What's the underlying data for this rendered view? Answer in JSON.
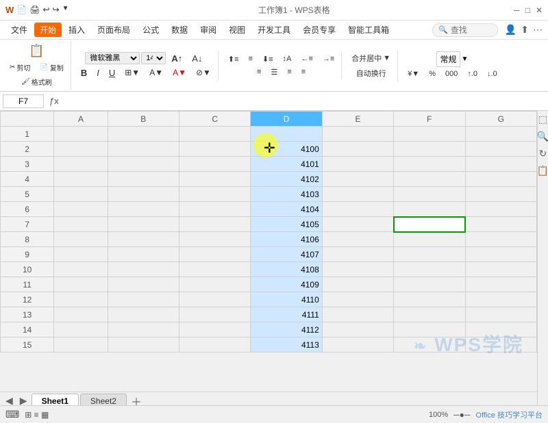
{
  "titlebar": {
    "title": "工作簿1 - WPS表格",
    "icons": [
      "⬜",
      "🖨",
      "↩",
      "↪",
      "▼"
    ]
  },
  "menubar": {
    "items": [
      "文件",
      "开始",
      "插入",
      "页面布局",
      "公式",
      "数据",
      "审阅",
      "视图",
      "开发工具",
      "会员专享",
      "智能工具箱"
    ],
    "active_index": 1,
    "search_placeholder": "查找"
  },
  "ribbon": {
    "paste_label": "粘贴",
    "cut_label": "剪切",
    "copy_label": "复制",
    "format_painter": "格式刷",
    "font_name": "微软雅黑",
    "font_size": "14",
    "bold_label": "B",
    "italic_label": "I",
    "underline_label": "U",
    "align_center": "居中",
    "merge_label": "合并居中",
    "wrap_label": "自动换行",
    "number_format": "常规"
  },
  "formula_bar": {
    "cell_ref": "F7",
    "formula": ""
  },
  "columns": [
    "A",
    "B",
    "C",
    "D",
    "E",
    "F",
    "G"
  ],
  "rows": [
    {
      "num": 1,
      "d": ""
    },
    {
      "num": 2,
      "d": "4100"
    },
    {
      "num": 3,
      "d": "4101"
    },
    {
      "num": 4,
      "d": "4102"
    },
    {
      "num": 5,
      "d": "4103"
    },
    {
      "num": 6,
      "d": "4104"
    },
    {
      "num": 7,
      "d": "4105"
    },
    {
      "num": 8,
      "d": "4106"
    },
    {
      "num": 9,
      "d": "4107"
    },
    {
      "num": 10,
      "d": "4108"
    },
    {
      "num": 11,
      "d": "4109"
    },
    {
      "num": 12,
      "d": "4110"
    },
    {
      "num": 13,
      "d": "4111"
    },
    {
      "num": 14,
      "d": "4112"
    },
    {
      "num": 15,
      "d": "4113"
    }
  ],
  "sheets": [
    "Sheet1",
    "Sheet2"
  ],
  "active_sheet": "Sheet1",
  "status": {
    "zoom": "100%",
    "office_text": "Office 技巧学习平台",
    "view_icons": [
      "⊞",
      "≡",
      "▦"
    ]
  },
  "wps_logo": "W WPS学院"
}
